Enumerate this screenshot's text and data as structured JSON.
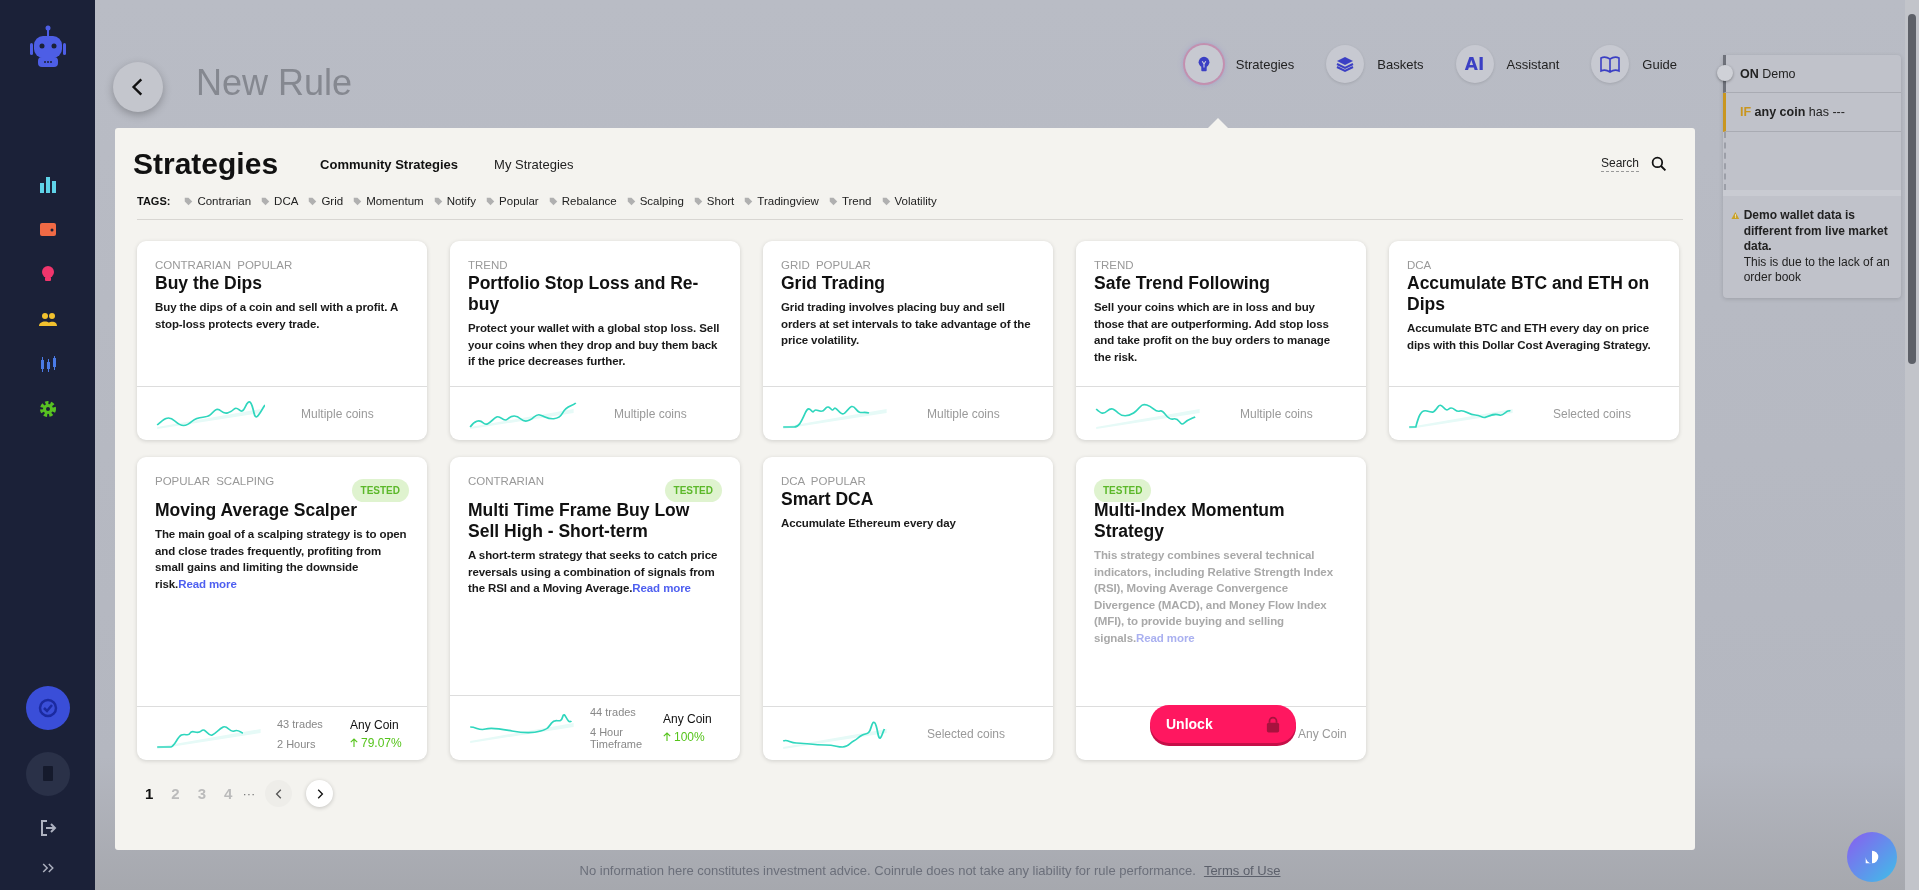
{
  "header": {
    "title": "New Rule"
  },
  "nav": [
    {
      "label": "Strategies",
      "kind": "bulb",
      "selected": true
    },
    {
      "label": "Baskets",
      "kind": "stack",
      "selected": false
    },
    {
      "label": "Assistant",
      "kind": "ai",
      "glyph": "AI",
      "selected": false
    },
    {
      "label": "Guide",
      "kind": "book",
      "selected": false
    }
  ],
  "rule_panel": {
    "status": "ON",
    "mode": "Demo",
    "condition_keyword": "IF",
    "condition_subject": "any coin",
    "condition_rest": "has ---",
    "warning_title": "Demo wallet data is different from live market data.",
    "warning_text": "This is due to the lack of an order book"
  },
  "strategies": {
    "title": "Strategies",
    "tabs": [
      {
        "label": "Community Strategies",
        "selected": true
      },
      {
        "label": "My Strategies",
        "selected": false
      }
    ],
    "search": "Search",
    "tags_label": "TAGS:",
    "tags": [
      "Contrarian",
      "DCA",
      "Grid",
      "Momentum",
      "Notify",
      "Popular",
      "Rebalance",
      "Scalping",
      "Short",
      "Tradingview",
      "Trend",
      "Volatility"
    ],
    "cards": [
      {
        "tags": [
          "CONTRARIAN",
          "POPULAR"
        ],
        "title": "Buy the Dips",
        "description": "Buy the dips of a coin and sell with a profit. A stop-loss protects every trade.",
        "tested": false,
        "locked": false,
        "footer": {
          "kind": "coins",
          "text": "Multiple coins"
        }
      },
      {
        "tags": [
          "TREND"
        ],
        "title": "Portfolio Stop Loss and Re-buy",
        "description": "Protect your wallet with a global stop loss. Sell your coins when they drop and buy them back if the price decreases further.",
        "tested": false,
        "locked": false,
        "footer": {
          "kind": "coins",
          "text": "Multiple coins"
        }
      },
      {
        "tags": [
          "GRID",
          "POPULAR"
        ],
        "title": "Grid Trading",
        "description": "Grid trading involves placing buy and sell orders at set intervals to take advantage of the price volatility.",
        "tested": false,
        "locked": false,
        "footer": {
          "kind": "coins",
          "text": "Multiple coins"
        }
      },
      {
        "tags": [
          "TREND"
        ],
        "title": "Safe Trend Following",
        "description": "Sell your coins which are in loss and buy those that are outperforming. Add stop loss and take profit on the buy orders to manage the risk.",
        "tested": false,
        "locked": false,
        "footer": {
          "kind": "coins",
          "text": "Multiple coins"
        }
      },
      {
        "tags": [
          "DCA"
        ],
        "title": "Accumulate BTC and ETH on Dips",
        "description": "Accumulate BTC and ETH every day on price dips with this Dollar Cost Averaging Strategy.",
        "tested": false,
        "locked": false,
        "footer": {
          "kind": "coins",
          "text": "Selected coins"
        }
      },
      {
        "tags": [
          "POPULAR",
          "SCALPING"
        ],
        "title": "Moving Average Scalper",
        "description": "The main goal of a scalping strategy is to open and close trades frequently, profiting from small gains and limiting the downside risk.",
        "read_more": "Read more",
        "tested": true,
        "badge": "TESTED",
        "locked": false,
        "footer": {
          "kind": "stats",
          "trades": "43 trades",
          "timeframe": "2 Hours",
          "coin": "Any Coin",
          "gain": "79.07%"
        }
      },
      {
        "tags": [
          "CONTRARIAN"
        ],
        "title": "Multi Time Frame Buy Low Sell High - Short-term",
        "description": "A short-term strategy that seeks to catch price reversals using a combination of signals from the RSI and a Moving Average.",
        "read_more": "Read more",
        "tested": true,
        "badge": "TESTED",
        "locked": false,
        "footer": {
          "kind": "stats",
          "trades": "44 trades",
          "timeframe": "4 Hour Timeframe",
          "coin": "Any Coin",
          "gain": "100%"
        }
      },
      {
        "tags": [
          "DCA",
          "POPULAR"
        ],
        "title": "Smart DCA",
        "description": "Accumulate Ethereum every day",
        "tested": false,
        "locked": false,
        "footer": {
          "kind": "coins",
          "text": "Selected coins"
        }
      },
      {
        "title": "Multi-Index Momentum Strategy",
        "description": "This strategy combines several technical indicators, including Relative Strength Index (RSI), Moving Average Convergence Divergence (MACD), and Money Flow Index (MFI), to provide buying and selling signals.",
        "read_more": "Read more",
        "tested": true,
        "badge": "TESTED",
        "locked": true,
        "unlock": "Unlock",
        "footer": {
          "kind": "stats",
          "coin": "Any Coin"
        }
      }
    ],
    "pagination": {
      "pages": [
        {
          "label": "1",
          "selected": true
        },
        {
          "label": "2",
          "selected": false
        },
        {
          "label": "3",
          "selected": false
        },
        {
          "label": "4",
          "selected": false
        }
      ],
      "ellipsis": "···"
    }
  },
  "footer": {
    "text": "No information here constitutes investment advice. Coinrule does not take any liability for rule performance.",
    "link": "Terms of Use"
  }
}
